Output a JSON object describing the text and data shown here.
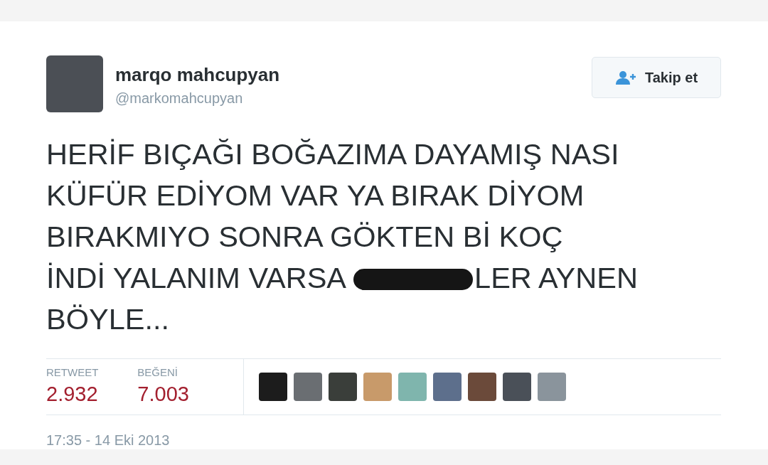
{
  "author": {
    "name": "marqo mahcupyan",
    "handle": "@markomahcupyan"
  },
  "follow_button": {
    "label": "Takip et"
  },
  "tweet_lines": [
    {
      "kind": "plain",
      "text": "HERİF BIÇAĞI BOĞAZIMA DAYAMIŞ NASI"
    },
    {
      "kind": "plain",
      "text": "KÜFÜR EDİYOM VAR YA BIRAK DİYOM"
    },
    {
      "kind": "plain",
      "text": "BIRAKMIYO SONRA GÖKTEN Bİ KOÇ"
    },
    {
      "kind": "censored",
      "before": "İNDİ YALANIM VARSA",
      "after": "LER AYNEN"
    },
    {
      "kind": "plain",
      "text": "BÖYLE..."
    }
  ],
  "stats": [
    {
      "label": "RETWEET",
      "value": "2.932"
    },
    {
      "label": "BEĞENİ",
      "value": "7.003"
    }
  ],
  "timestamp": "17:35 - 14 Eki 2013"
}
